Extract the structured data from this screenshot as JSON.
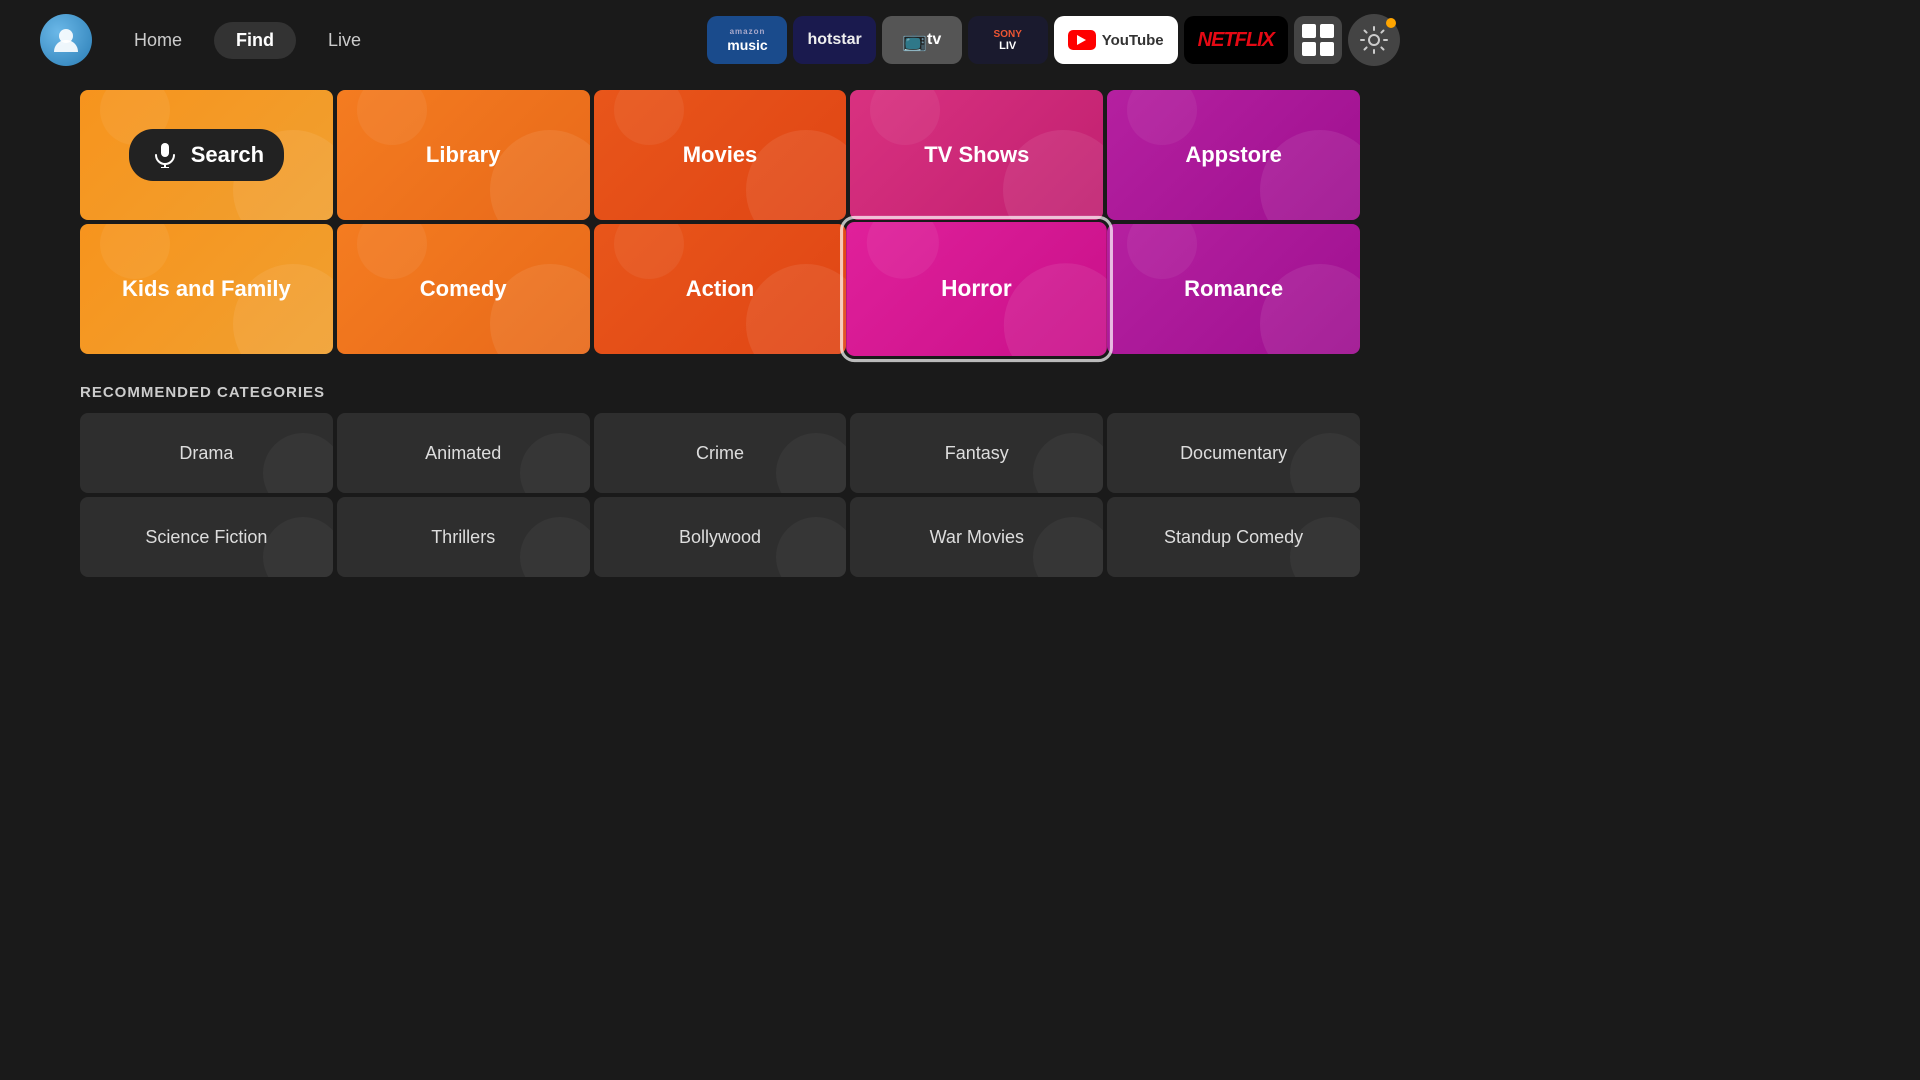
{
  "nav": {
    "home_label": "Home",
    "find_label": "Find",
    "live_label": "Live"
  },
  "apps": [
    {
      "id": "amazon-music",
      "label": "amazon music",
      "top": "amazon",
      "bottom": "music"
    },
    {
      "id": "hotstar",
      "label": "hotstar"
    },
    {
      "id": "tv",
      "label": "tv"
    },
    {
      "id": "sony-liv",
      "label": "SONY LIV"
    },
    {
      "id": "youtube",
      "label": "YouTube"
    },
    {
      "id": "netflix",
      "label": "NETFLIX"
    }
  ],
  "category_tiles": [
    {
      "id": "search",
      "label": "Search",
      "type": "search"
    },
    {
      "id": "library",
      "label": "Library",
      "type": "library"
    },
    {
      "id": "movies",
      "label": "Movies",
      "type": "movies"
    },
    {
      "id": "tvshows",
      "label": "TV Shows",
      "type": "tvshows"
    },
    {
      "id": "appstore",
      "label": "Appstore",
      "type": "appstore"
    },
    {
      "id": "kids",
      "label": "Kids and Family",
      "type": "kids"
    },
    {
      "id": "comedy",
      "label": "Comedy",
      "type": "comedy"
    },
    {
      "id": "action",
      "label": "Action",
      "type": "action"
    },
    {
      "id": "horror",
      "label": "Horror",
      "type": "horror"
    },
    {
      "id": "romance",
      "label": "Romance",
      "type": "romance"
    }
  ],
  "recommended_title": "RECOMMENDED CATEGORIES",
  "recommended_tiles": [
    {
      "id": "drama",
      "label": "Drama"
    },
    {
      "id": "animated",
      "label": "Animated"
    },
    {
      "id": "crime",
      "label": "Crime"
    },
    {
      "id": "fantasy",
      "label": "Fantasy"
    },
    {
      "id": "documentary",
      "label": "Documentary"
    },
    {
      "id": "sci-fi",
      "label": "Science Fiction"
    },
    {
      "id": "thrillers",
      "label": "Thrillers"
    },
    {
      "id": "bollywood",
      "label": "Bollywood"
    },
    {
      "id": "war-movies",
      "label": "War Movies"
    },
    {
      "id": "standup-comedy",
      "label": "Standup Comedy"
    }
  ]
}
